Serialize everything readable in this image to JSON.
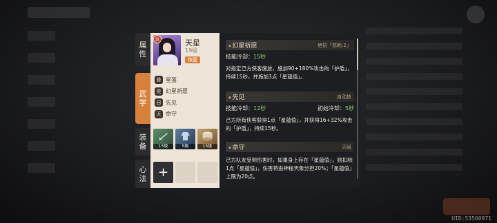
{
  "uid": "UID:53560971",
  "tabs": [
    {
      "label_a": "属",
      "label_b": "性"
    },
    {
      "label_a": "武",
      "label_b": "学"
    },
    {
      "label_a": "装",
      "label_b": "备"
    },
    {
      "label_a": "心",
      "label_b": "法"
    }
  ],
  "hero": {
    "element_badge": "炎",
    "name": "天星",
    "level": "19级",
    "tag": "恢复"
  },
  "skills": [
    {
      "icon": "普",
      "name": "星落"
    },
    {
      "icon": "奕",
      "name": "幻星祈愿"
    },
    {
      "icon": "自",
      "name": "先见"
    },
    {
      "icon": "天",
      "name": "命守"
    }
  ],
  "equipment": [
    {
      "level": "15级",
      "icon": "sword-icon"
    },
    {
      "level": "5级",
      "icon": "robe-icon"
    },
    {
      "level": "15级",
      "icon": "drum-icon"
    }
  ],
  "heart_method": {
    "add_label": "+"
  },
  "details": [
    {
      "title": "幻星祈愿",
      "tag": "绝招「怒耗:2」",
      "stat_left_label": "技能冷却：",
      "stat_left_value": "15秒",
      "stat_right_label": "",
      "stat_right_value": "",
      "desc": "对指定己方侠客施放，施加90+180%攻击的「护盾」，持续15秒，并施加3点「星蕴值」。"
    },
    {
      "title": "先见",
      "tag": "自动技",
      "stat_left_label": "技能冷却：",
      "stat_left_value": "12秒",
      "stat_right_label": "初始冷却：",
      "stat_right_value": "5秒",
      "desc": "己方所有侠客获得1点「星蕴值」，并获得16+32%攻击的「护盾」，持续15秒。"
    },
    {
      "title": "命守",
      "tag": "天赋",
      "stat_left_label": "",
      "stat_left_value": "",
      "stat_right_label": "",
      "stat_right_value": "",
      "desc": "己方队友受到伤害时，如果身上存在「星蕴值」，则扣除1点「星蕴值」，伤害将由神秘天象分担20%；「星蕴值」上限为20点。"
    }
  ]
}
